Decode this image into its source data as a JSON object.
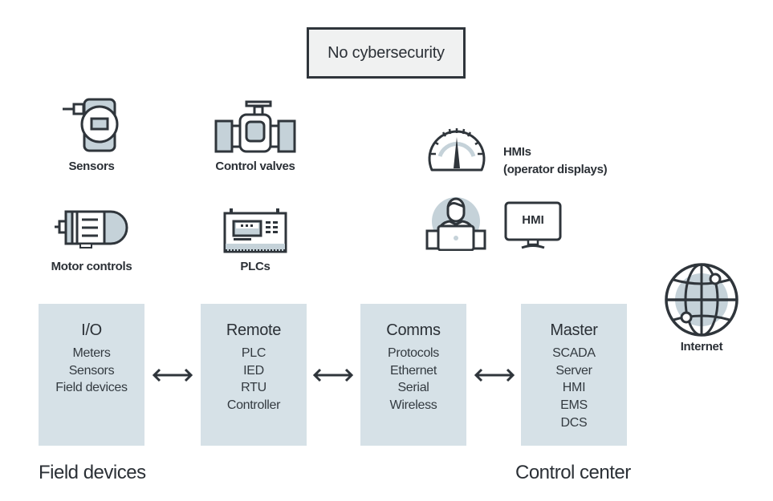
{
  "title": "No cybersecurity",
  "devices": {
    "sensors": "Sensors",
    "control_valves": "Control valves",
    "motor_controls": "Motor controls",
    "plcs": "PLCs",
    "hmis_line1": "HMIs",
    "hmis_line2": "(operator displays)",
    "hmi_screen": "HMI",
    "internet": "Internet"
  },
  "blocks": [
    {
      "title": "I/O",
      "items": [
        "Meters",
        "Sensors",
        "Field devices"
      ]
    },
    {
      "title": "Remote",
      "items": [
        "PLC",
        "IED",
        "RTU",
        "Controller"
      ]
    },
    {
      "title": "Comms",
      "items": [
        "Protocols",
        "Ethernet",
        "Serial",
        "Wireless"
      ]
    },
    {
      "title": "Master",
      "items": [
        "SCADA",
        "Server",
        "HMI",
        "EMS",
        "DCS"
      ]
    }
  ],
  "sections": {
    "left": "Field devices",
    "right": "Control center"
  },
  "colors": {
    "stroke": "#2f353b",
    "fill_light": "#c5d2d9",
    "block_bg": "#d6e1e7",
    "title_bg": "#f0f1f1"
  }
}
